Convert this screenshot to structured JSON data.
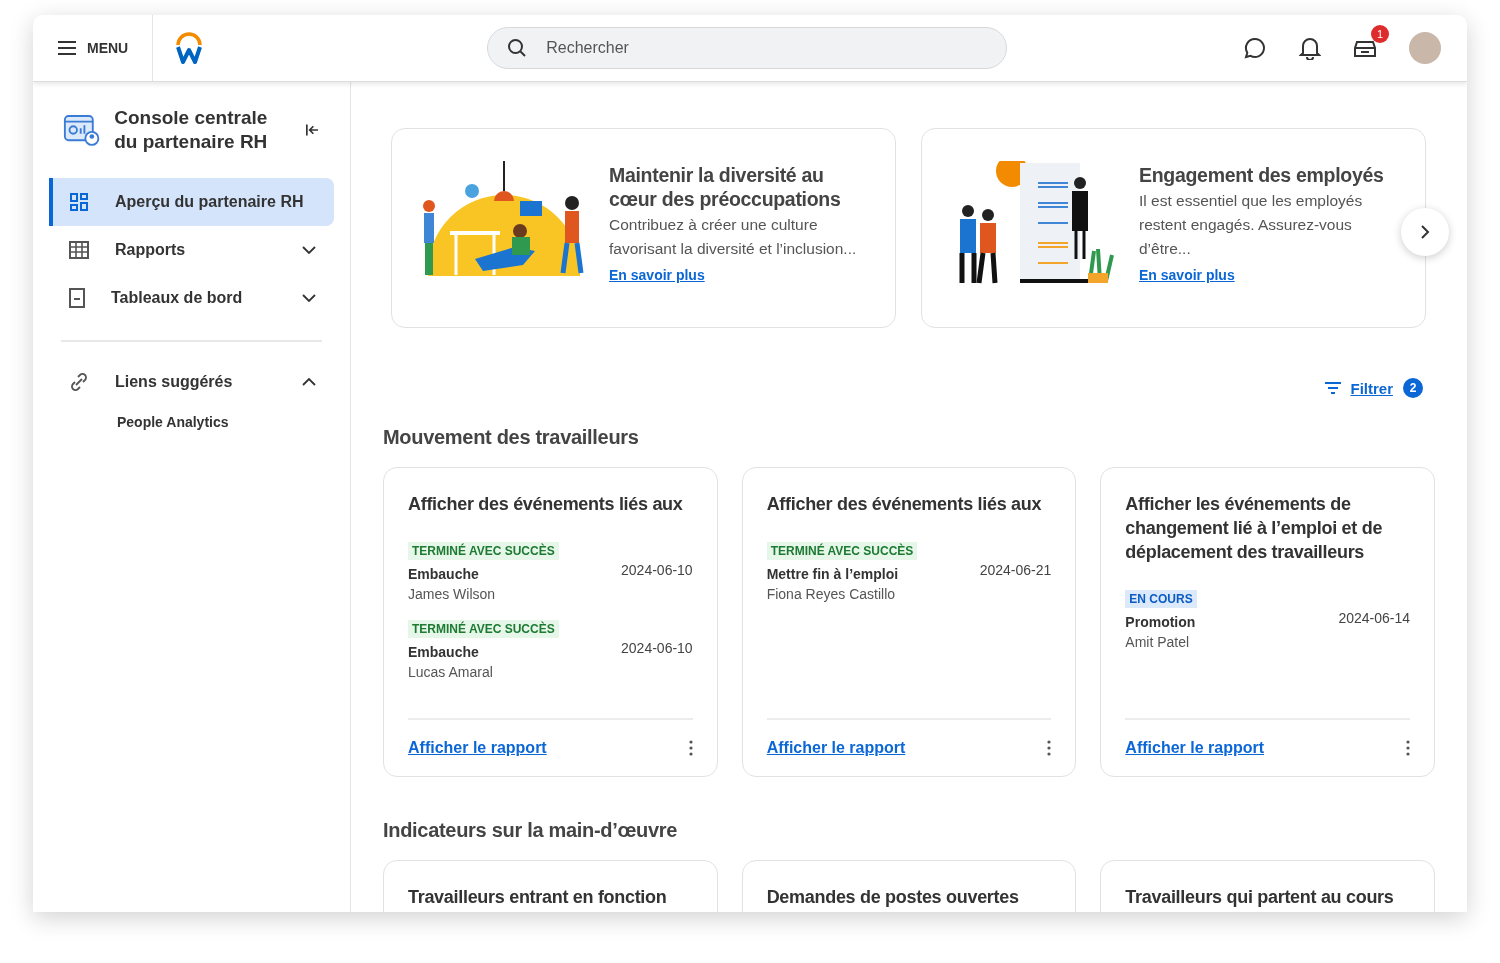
{
  "header": {
    "menu_label": "MENU",
    "search": {
      "placeholder": "Rechercher"
    },
    "inbox_badge": "1"
  },
  "sidebar": {
    "title": "Console centrale du partenaire RH",
    "items": [
      {
        "label": "Aperçu du partenaire RH",
        "kind": "grid",
        "selected": true
      },
      {
        "label": "Rapports",
        "kind": "table",
        "selected": false,
        "expanded": false
      },
      {
        "label": "Tableaux de bord",
        "kind": "document",
        "selected": false,
        "expanded": false
      }
    ],
    "suggested": {
      "label": "Liens suggérés",
      "expanded": true,
      "children": [
        {
          "label": "People Analytics"
        }
      ]
    }
  },
  "carousel": [
    {
      "title": "Maintenir la diversité au cœur des préoccupations",
      "text": "Contribuez à créer une culture favorisant la diversité et l’inclusion...",
      "link": "En savoir plus",
      "kind": "office"
    },
    {
      "title": "Engagement des employés",
      "text": "Il est essentiel que les employés restent engagés. Assurez-vous d’être...",
      "link": "En savoir plus",
      "kind": "checklist"
    }
  ],
  "filter": {
    "label": "Filtrer",
    "count": "2"
  },
  "sections": [
    {
      "title": "Mouvement des travailleurs",
      "cards": [
        {
          "title": "Afficher des événements liés aux",
          "events": [
            {
              "status": "TERMINÉ AVEC SUCCÈS",
              "kind": "success",
              "type": "Embauche",
              "name": "James Wilson",
              "date": "2024-06-10"
            },
            {
              "status": "TERMINÉ AVEC SUCCÈS",
              "kind": "success",
              "type": "Embauche",
              "name": "Lucas Amaral",
              "date": "2024-06-10"
            }
          ],
          "link": "Afficher le rapport"
        },
        {
          "title": "Afficher des événements liés aux",
          "events": [
            {
              "status": "TERMINÉ AVEC SUCCÈS",
              "kind": "success",
              "type": "Mettre fin à l’emploi",
              "name": "Fiona Reyes Castillo",
              "date": "2024-06-21"
            }
          ],
          "link": "Afficher le rapport"
        },
        {
          "title": "Afficher les événements de changement lié à l’emploi et de déplacement des travailleurs",
          "events": [
            {
              "status": "EN COURS",
              "kind": "in_progress",
              "type": "Promotion",
              "name": "Amit Patel",
              "date": "2024-06-14"
            }
          ],
          "link": "Afficher le rapport"
        }
      ]
    },
    {
      "title": "Indicateurs sur la main-d’œuvre",
      "cards": [
        {
          "title": "Travailleurs entrant en fonction"
        },
        {
          "title": "Demandes de postes ouvertes"
        },
        {
          "title": "Travailleurs qui partent au cours"
        }
      ]
    }
  ]
}
